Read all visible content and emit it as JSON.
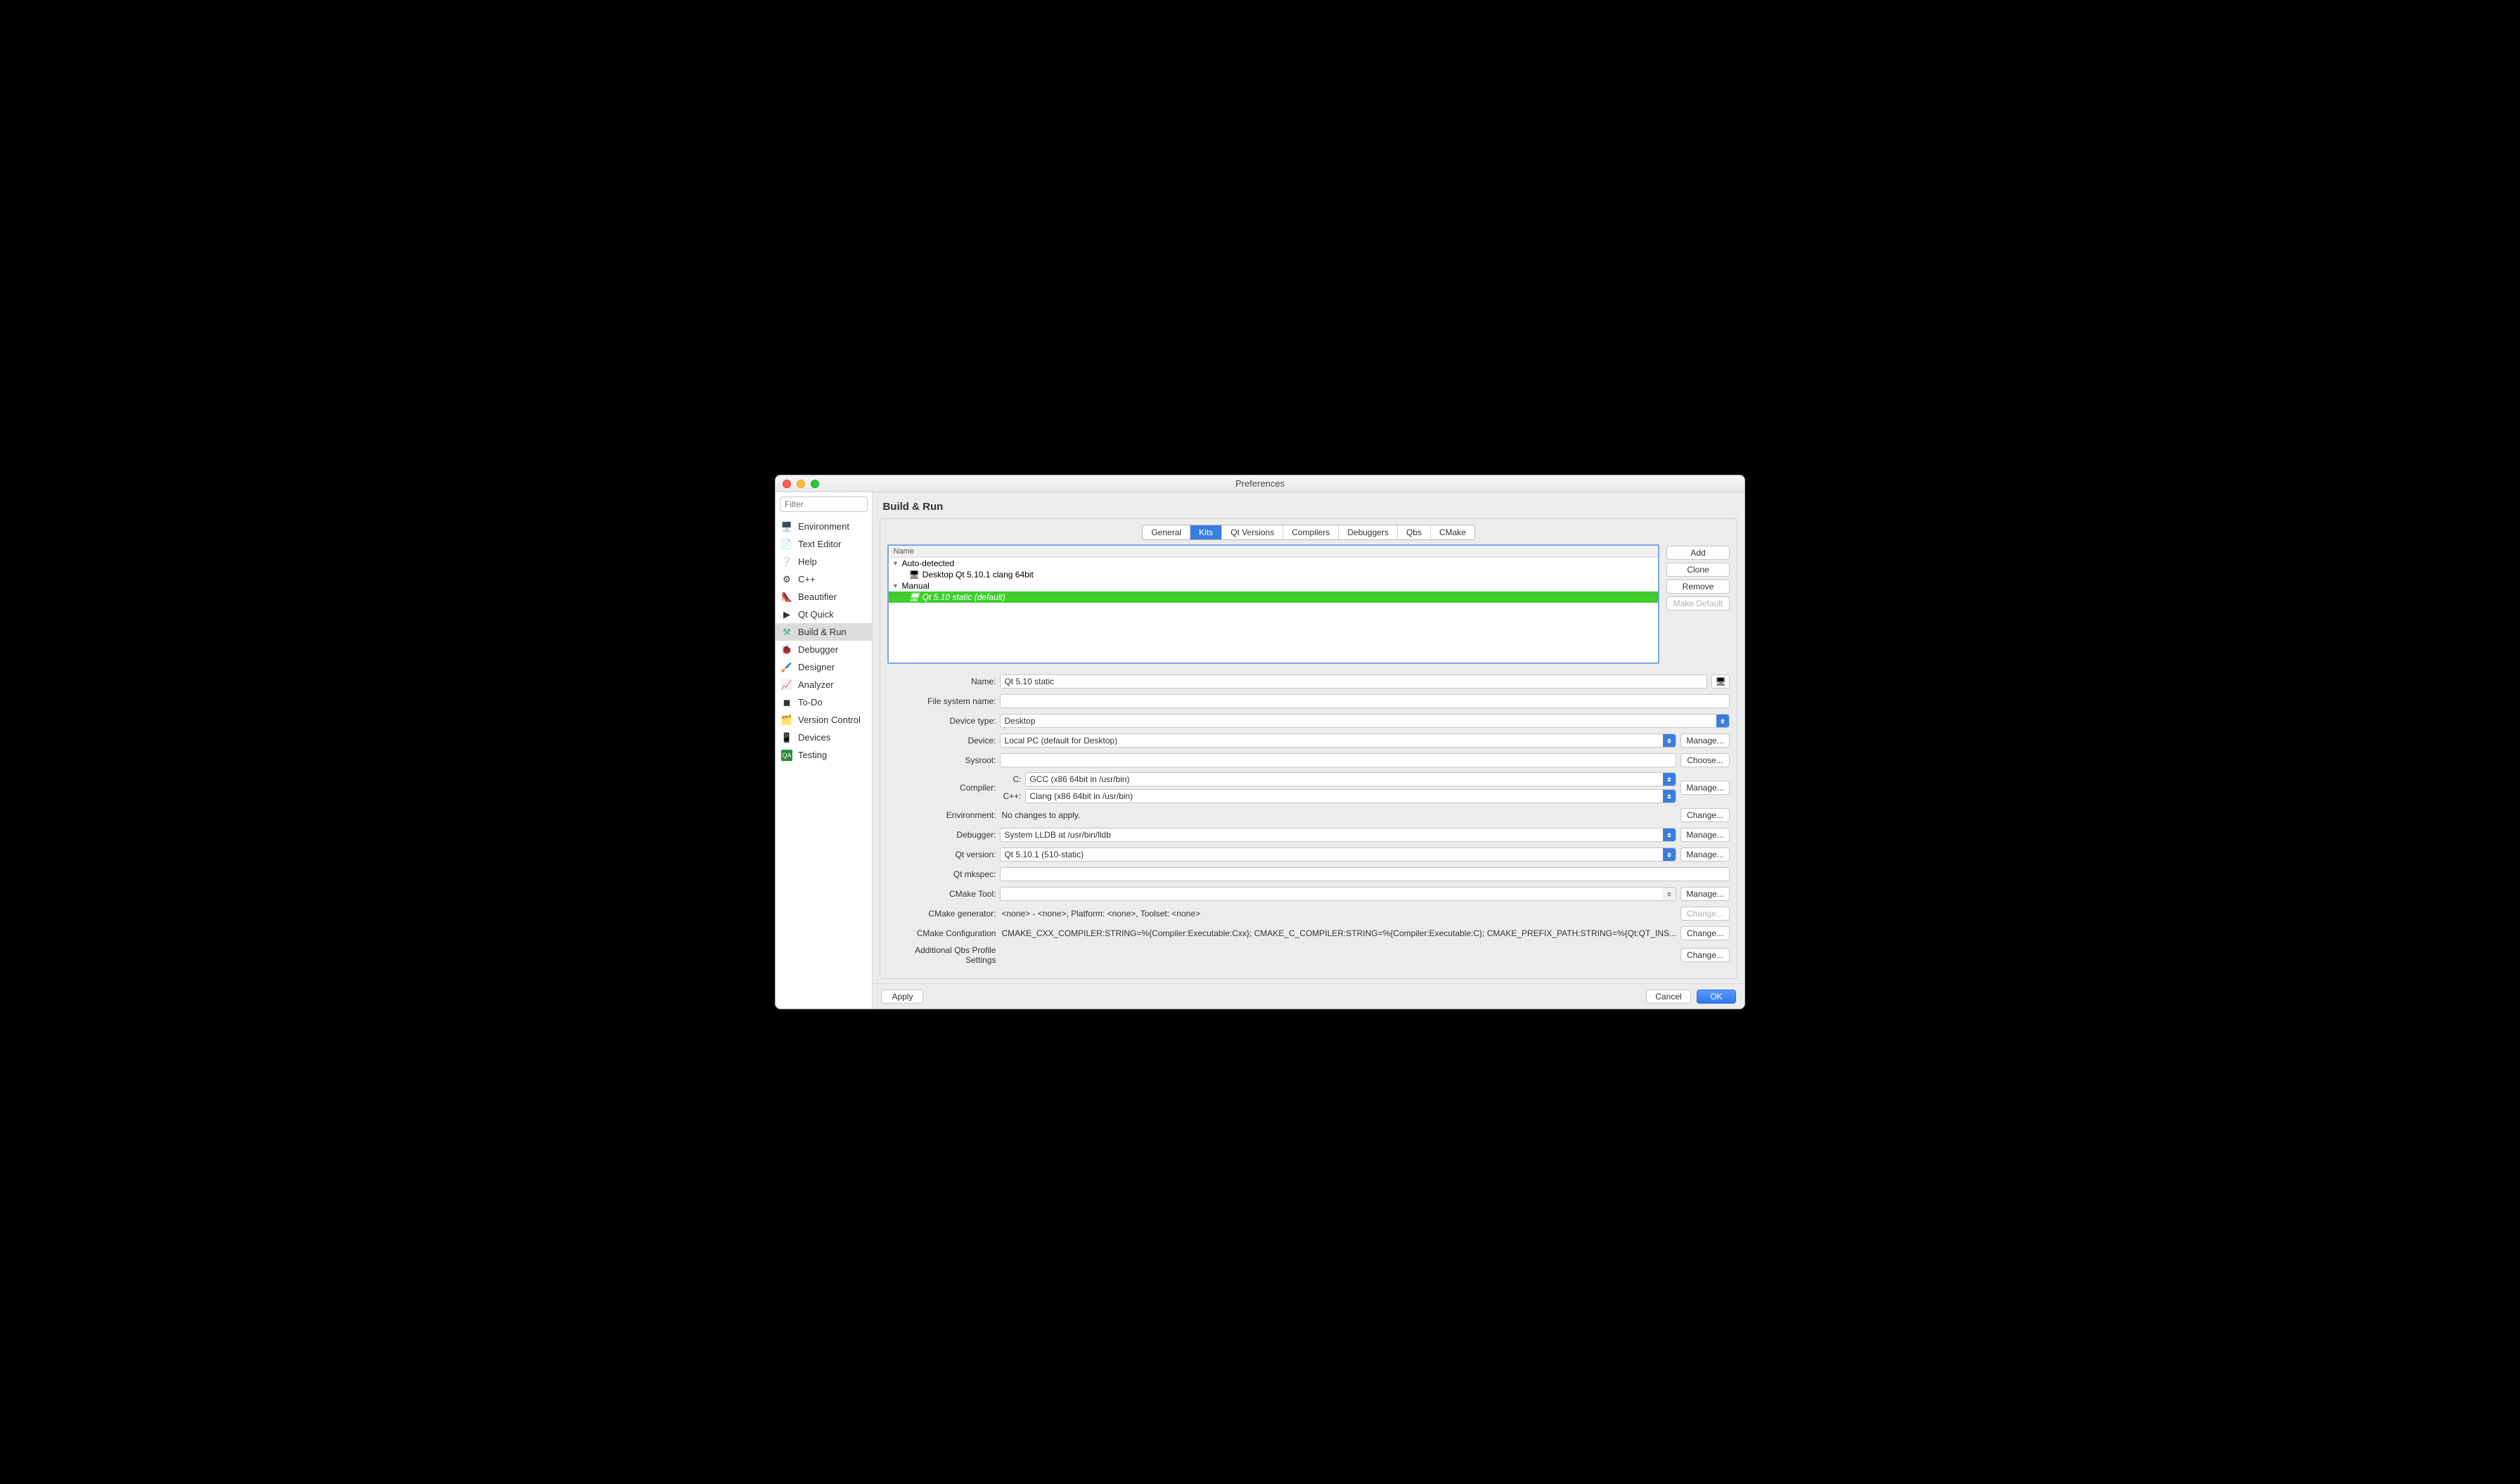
{
  "window": {
    "title": "Preferences"
  },
  "filter": {
    "placeholder": "Filter"
  },
  "categories": [
    {
      "label": "Environment"
    },
    {
      "label": "Text Editor"
    },
    {
      "label": "Help"
    },
    {
      "label": "C++"
    },
    {
      "label": "Beautifier"
    },
    {
      "label": "Qt Quick"
    },
    {
      "label": "Build & Run"
    },
    {
      "label": "Debugger"
    },
    {
      "label": "Designer"
    },
    {
      "label": "Analyzer"
    },
    {
      "label": "To-Do"
    },
    {
      "label": "Version Control"
    },
    {
      "label": "Devices"
    },
    {
      "label": "Testing"
    }
  ],
  "page_title": "Build & Run",
  "tabs": [
    "General",
    "Kits",
    "Qt Versions",
    "Compilers",
    "Debuggers",
    "Qbs",
    "CMake"
  ],
  "tree": {
    "header": "Name",
    "auto_label": "Auto-detected",
    "auto_item": "Desktop Qt 5.10.1 clang 64bit",
    "manual_label": "Manual",
    "manual_item": "Qt 5.10 static (default)"
  },
  "kits_buttons": {
    "add": "Add",
    "clone": "Clone",
    "remove": "Remove",
    "make_default": "Make Default"
  },
  "form": {
    "name_label": "Name:",
    "name_value": "Qt 5.10 static",
    "fsname_label": "File system name:",
    "fsname_value": "",
    "device_type_label": "Device type:",
    "device_type_value": "Desktop",
    "device_label": "Device:",
    "device_value": "Local PC (default for Desktop)",
    "sysroot_label": "Sysroot:",
    "sysroot_value": "",
    "compiler_label": "Compiler:",
    "compiler_c_label": "C:",
    "compiler_c_value": "GCC (x86 64bit in /usr/bin)",
    "compiler_cxx_label": "C++:",
    "compiler_cxx_value": "Clang (x86 64bit in /usr/bin)",
    "env_label": "Environment:",
    "env_value": "No changes to apply.",
    "debugger_label": "Debugger:",
    "debugger_value": "System LLDB at /usr/bin/lldb",
    "qt_version_label": "Qt version:",
    "qt_version_value": "Qt 5.10.1 (510-static)",
    "mkspec_label": "Qt mkspec:",
    "mkspec_value": "",
    "cmake_tool_label": "CMake Tool:",
    "cmake_tool_value": "",
    "cmake_gen_label": "CMake generator:",
    "cmake_gen_value": "<none> - <none>, Platform: <none>, Toolset: <none>",
    "cmake_conf_label": "CMake Configuration",
    "cmake_conf_value": "CMAKE_CXX_COMPILER:STRING=%{Compiler:Executable:Cxx}; CMAKE_C_COMPILER:STRING=%{Compiler:Executable:C}; CMAKE_PREFIX_PATH:STRING=%{Qt:QT_INS...",
    "qbs_label": "Additional Qbs Profile Settings",
    "manage": "Manage...",
    "choose": "Choose...",
    "change": "Change..."
  },
  "footer": {
    "apply": "Apply",
    "cancel": "Cancel",
    "ok": "OK"
  }
}
